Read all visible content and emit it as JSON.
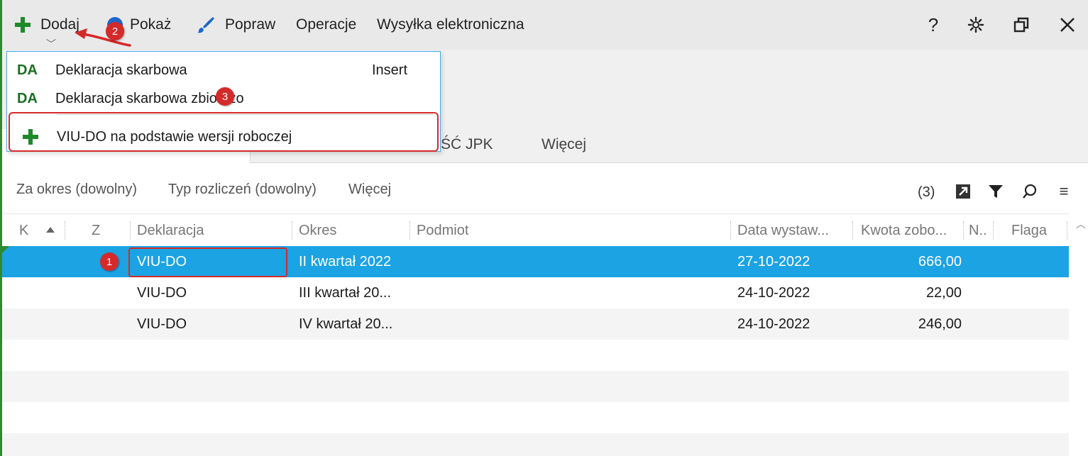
{
  "toolbar": {
    "add_label": "Dodaj",
    "show_label": "Pokaż",
    "edit_label": "Popraw",
    "operations_label": "Operacje",
    "send_label": "Wysyłka elektroniczna",
    "help_glyph": "?",
    "icons": [
      "plus-icon",
      "globe-icon",
      "brush-icon",
      "gear-icon",
      "restore-icon",
      "close-icon"
    ]
  },
  "dropdown": {
    "items": [
      {
        "icon_text": "DA",
        "label": "Deklaracja skarbowa",
        "shortcut": "Insert"
      },
      {
        "icon_text": "DA",
        "label": "Deklaracja skarbowa zbiorczo",
        "shortcut": ""
      },
      {
        "icon": "plus-icon",
        "label": "VIU-DO na podstawie wersji roboczej"
      }
    ]
  },
  "tabs": {
    "jpk": "ŚĆ JPK",
    "more": "Więcej"
  },
  "filters": {
    "period": "Za okres (dowolny)",
    "type": "Typ rozliczeń (dowolny)",
    "more": "Więcej",
    "count": "(3)"
  },
  "grid": {
    "columns": {
      "k": "K",
      "z": "Z",
      "declaration": "Deklaracja",
      "period": "Okres",
      "entity": "Podmiot",
      "issue_date": "Data wystaw...",
      "amount": "Kwota zobo...",
      "n": "N..",
      "flag": "Flaga"
    },
    "rows": [
      {
        "declaration": "VIU-DO",
        "period": "II kwartał 2022",
        "issue_date": "27-10-2022",
        "amount": "666,00",
        "selected": true
      },
      {
        "declaration": "VIU-DO",
        "period": "III kwartał 20...",
        "issue_date": "24-10-2022",
        "amount": "22,00",
        "selected": false
      },
      {
        "declaration": "VIU-DO",
        "period": "IV kwartał 20...",
        "issue_date": "24-10-2022",
        "amount": "246,00",
        "selected": false
      }
    ]
  },
  "annotations": {
    "badge_1": "1",
    "badge_2": "2",
    "badge_3": "3"
  },
  "colors": {
    "accent_green": "#1d8a2a",
    "selection_blue": "#1ba3e3",
    "annotation_red": "#d42a2a"
  }
}
